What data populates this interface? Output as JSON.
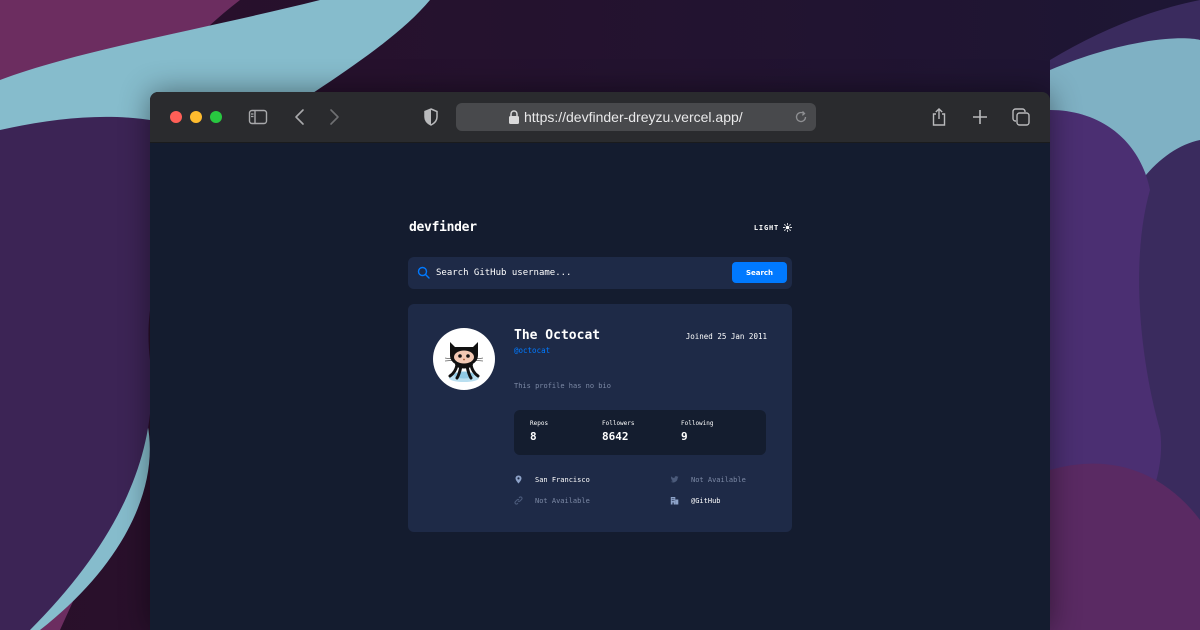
{
  "browser": {
    "url": "https://devfinder-dreyzu.vercel.app/"
  },
  "app": {
    "logo": "devfinder",
    "theme_toggle_label": "LIGHT",
    "search": {
      "placeholder": "Search GitHub username...",
      "button_label": "Search"
    },
    "profile": {
      "name": "The Octocat",
      "login": "@octocat",
      "joined": "Joined 25 Jan 2011",
      "bio": "This profile has no bio",
      "stats": {
        "repos_label": "Repos",
        "repos_value": "8",
        "followers_label": "Followers",
        "followers_value": "8642",
        "following_label": "Following",
        "following_value": "9"
      },
      "location": "San Francisco",
      "blog": "Not Available",
      "twitter": "Not Available",
      "company": "@GitHub"
    }
  },
  "colors": {
    "accent": "#0079ff",
    "card_bg": "#1e2a47",
    "page_bg": "#141d2f",
    "muted_text": "#7d8aa6"
  },
  "icons": {
    "toolbar": [
      "sidebar-icon",
      "back-icon",
      "forward-icon",
      "shield-icon",
      "lock-icon",
      "reload-icon",
      "share-icon",
      "plus-icon",
      "tabs-icon"
    ],
    "app": [
      "sun-icon",
      "search-icon",
      "location-icon",
      "link-icon",
      "twitter-icon",
      "company-icon"
    ]
  }
}
